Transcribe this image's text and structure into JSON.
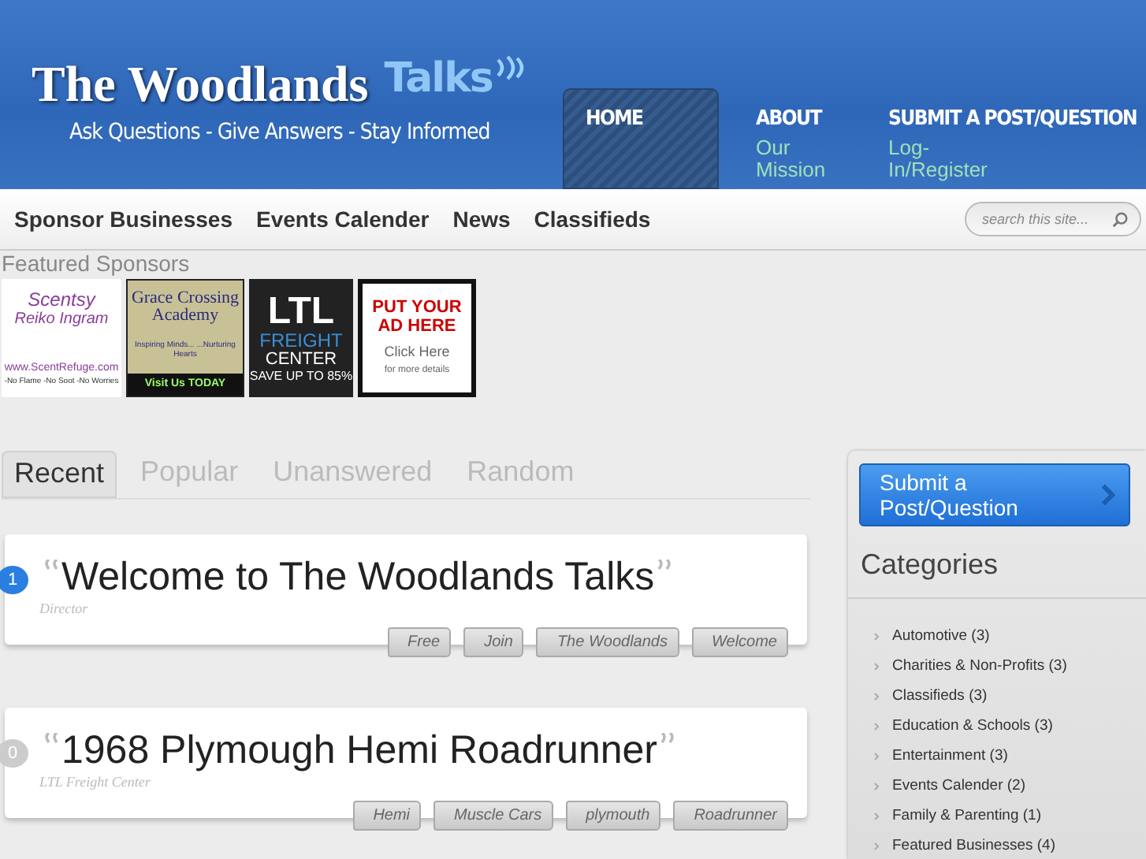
{
  "header": {
    "logo": {
      "title": "The Woodlands",
      "accent": "Talks"
    },
    "tagline": "Ask Questions - Give Answers - Stay Informed",
    "nav": [
      {
        "label": "HOME",
        "selected": true
      },
      {
        "label": "ABOUT",
        "subtitle": "Our Mission",
        "selected": false
      },
      {
        "label": "SUBMIT A POST/QUESTION",
        "subtitle": "Log-In/Register",
        "selected": false
      }
    ]
  },
  "subnav": {
    "links": [
      "Sponsor Businesses",
      "Events Calender",
      "News",
      "Classifieds"
    ],
    "search": {
      "placeholder": "search this site..."
    }
  },
  "sponsors": {
    "title": "Featured Sponsors",
    "ads": [
      {
        "kind": "scentsy",
        "lines": [
          "Scentsy",
          "Reiko Ingram",
          "www.ScentRefuge.com",
          "-No Flame -No Soot -No Worries"
        ]
      },
      {
        "kind": "grace",
        "lines": [
          "Grace Crossing Academy",
          "Inspiring Minds... ...Nurturing Hearts",
          "Visit Us TODAY"
        ]
      },
      {
        "kind": "ltl",
        "lines": [
          "LTL",
          "FREIGHT",
          "CENTER",
          "SAVE UP TO 85%"
        ]
      },
      {
        "kind": "adhere",
        "lines": [
          "PUT YOUR AD HERE",
          "Click Here",
          "for more details"
        ]
      }
    ]
  },
  "tabs": [
    {
      "label": "Recent",
      "selected": true
    },
    {
      "label": "Popular",
      "selected": false
    },
    {
      "label": "Unanswered",
      "selected": false
    },
    {
      "label": "Random",
      "selected": false
    }
  ],
  "posts": [
    {
      "title": "Welcome to The Woodlands Talks",
      "author": "Director",
      "comments": "1",
      "has_comments": true,
      "tags": [
        "Free",
        "Join",
        "The Woodlands",
        "Welcome"
      ]
    },
    {
      "title": "1968 Plymough Hemi Roadrunner",
      "author": "LTL Freight Center",
      "comments": "0",
      "has_comments": false,
      "tags": [
        "Hemi",
        "Muscle Cars",
        "plymouth",
        "Roadrunner"
      ]
    }
  ],
  "sidebar": {
    "submit_button": "Submit a Post/Question",
    "categories_title": "Categories",
    "categories": [
      "Automotive (3)",
      "Charities & Non-Profits (3)",
      "Classifieds (3)",
      "Education & Schools (3)",
      "Entertainment (3)",
      "Events Calender (2)",
      "Family & Parenting (1)",
      "Featured Businesses (4)"
    ]
  }
}
